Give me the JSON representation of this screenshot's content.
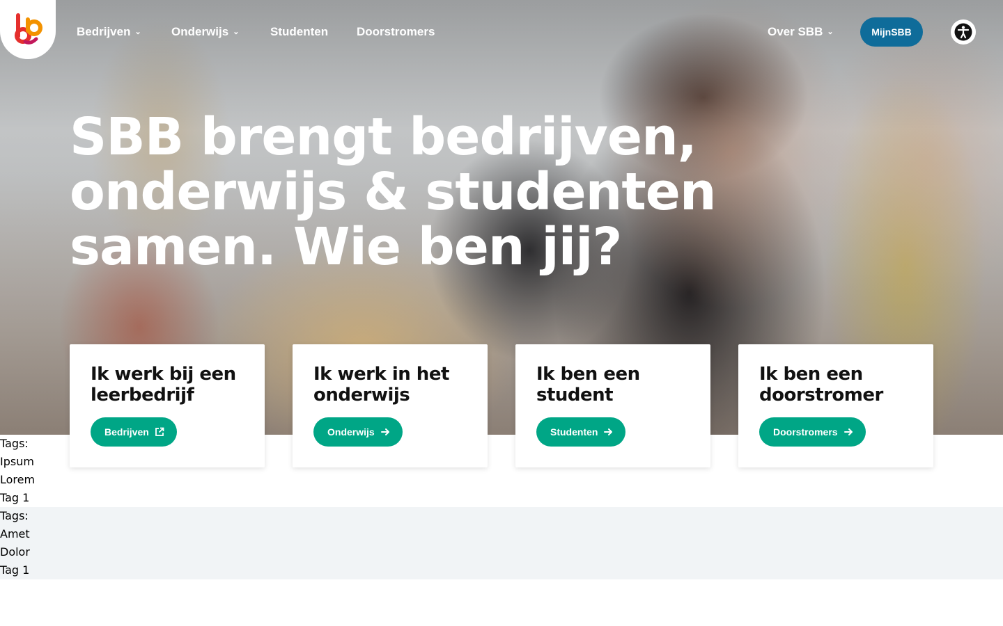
{
  "header": {
    "logo": "sbb-logo",
    "nav": [
      {
        "label": "Bedrijven",
        "has_dropdown": true
      },
      {
        "label": "Onderwijs",
        "has_dropdown": true
      },
      {
        "label": "Studenten",
        "has_dropdown": false
      },
      {
        "label": "Doorstromers",
        "has_dropdown": false
      }
    ],
    "over": {
      "label": "Over SBB",
      "has_dropdown": true
    },
    "mijn_label": "MijnSBB",
    "accessibility_icon": "accessibility-icon"
  },
  "hero": {
    "headline": "SBB brengt bedrijven, onderwijs & studenten samen. Wie ben jij?"
  },
  "cards": [
    {
      "title": "Ik werk bij een leerbedrijf",
      "button": "Bedrijven",
      "icon": "external-link-icon"
    },
    {
      "title": "Ik werk in het onderwijs",
      "button": "Onderwijs",
      "icon": "arrow-right-icon"
    },
    {
      "title": "Ik ben een student",
      "button": "Studenten",
      "icon": "arrow-right-icon"
    },
    {
      "title": "Ik ben een doorstromer",
      "button": "Doorstromers",
      "icon": "arrow-right-icon"
    }
  ],
  "tag_blocks": [
    {
      "heading": "Tags:",
      "tags": [
        "Ipsum",
        "Lorem",
        "Tag 1"
      ]
    },
    {
      "heading": "Tags:",
      "tags": [
        "Amet",
        "Dolor",
        "Tag 1"
      ]
    }
  ],
  "colors": {
    "brand_blue": "#0f6c9a",
    "brand_green": "#00a686",
    "logo_red": "#e52f2d",
    "logo_orange": "#f39200"
  }
}
